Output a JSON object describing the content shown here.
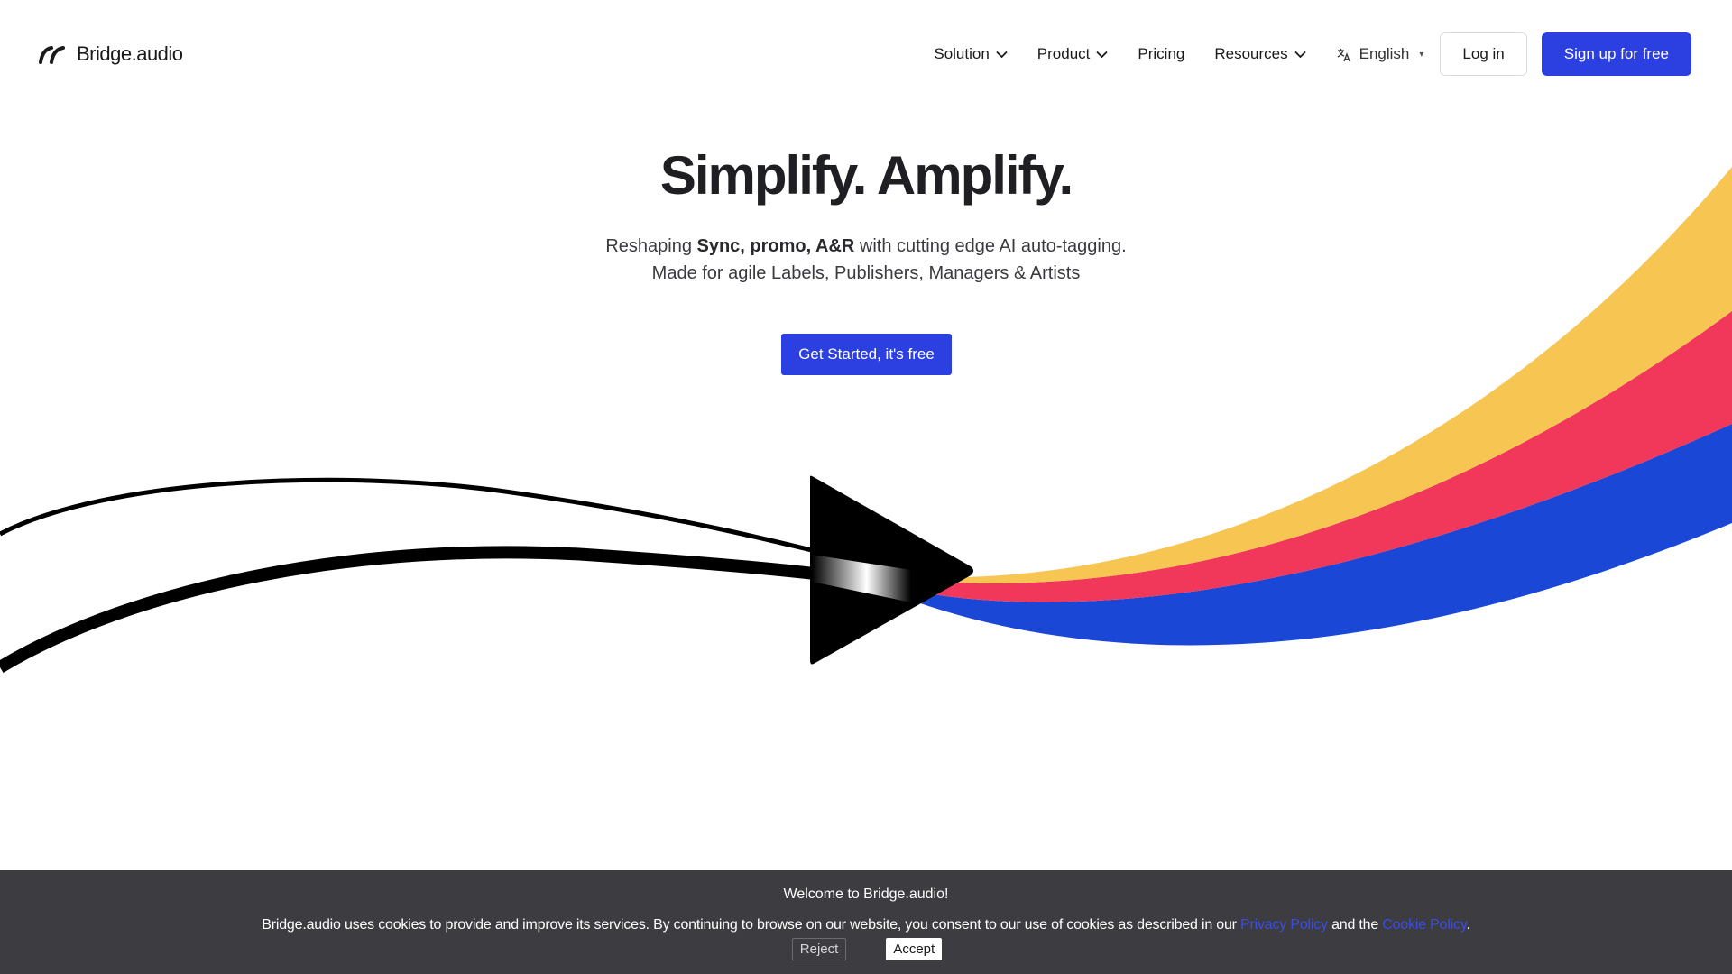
{
  "brand": {
    "name": "Bridge.audio",
    "logo_icon": "bridge-arc-icon"
  },
  "nav": {
    "items": [
      {
        "label": "Solution",
        "dropdown": true
      },
      {
        "label": "Product",
        "dropdown": true
      },
      {
        "label": "Pricing",
        "dropdown": false
      },
      {
        "label": "Resources",
        "dropdown": true
      }
    ],
    "language": {
      "label": "English",
      "icon": "translate-icon"
    },
    "login_label": "Log in",
    "signup_label": "Sign up for free"
  },
  "hero": {
    "title": "Simplify. Amplify.",
    "line1_prefix": "Reshaping ",
    "line1_bold": "Sync, promo, A&R",
    "line1_suffix": " with cutting edge AI auto-tagging.",
    "line2": "Made for agile Labels, Publishers, Managers & Artists",
    "cta_label": "Get Started, it's free"
  },
  "illustration": {
    "icon": "play-arrow-icon",
    "colors": {
      "yellow": "#f7c552",
      "red": "#f2385a",
      "blue": "#1b47d6",
      "black": "#000000"
    }
  },
  "cookie_banner": {
    "title": "Welcome to Bridge.audio!",
    "text_prefix": "Bridge.audio uses cookies to provide and improve its services. By continuing to browse on our website, you consent to our use of cookies as described in our ",
    "privacy_link": "Privacy Policy",
    "text_middle": " and the ",
    "cookie_link": "Cookie Policy",
    "text_suffix": ".",
    "reject_label": "Reject",
    "accept_label": "Accept"
  },
  "colors": {
    "accent": "#2c3fe0",
    "banner_bg": "#3c3c41",
    "link": "#3a4de6"
  }
}
